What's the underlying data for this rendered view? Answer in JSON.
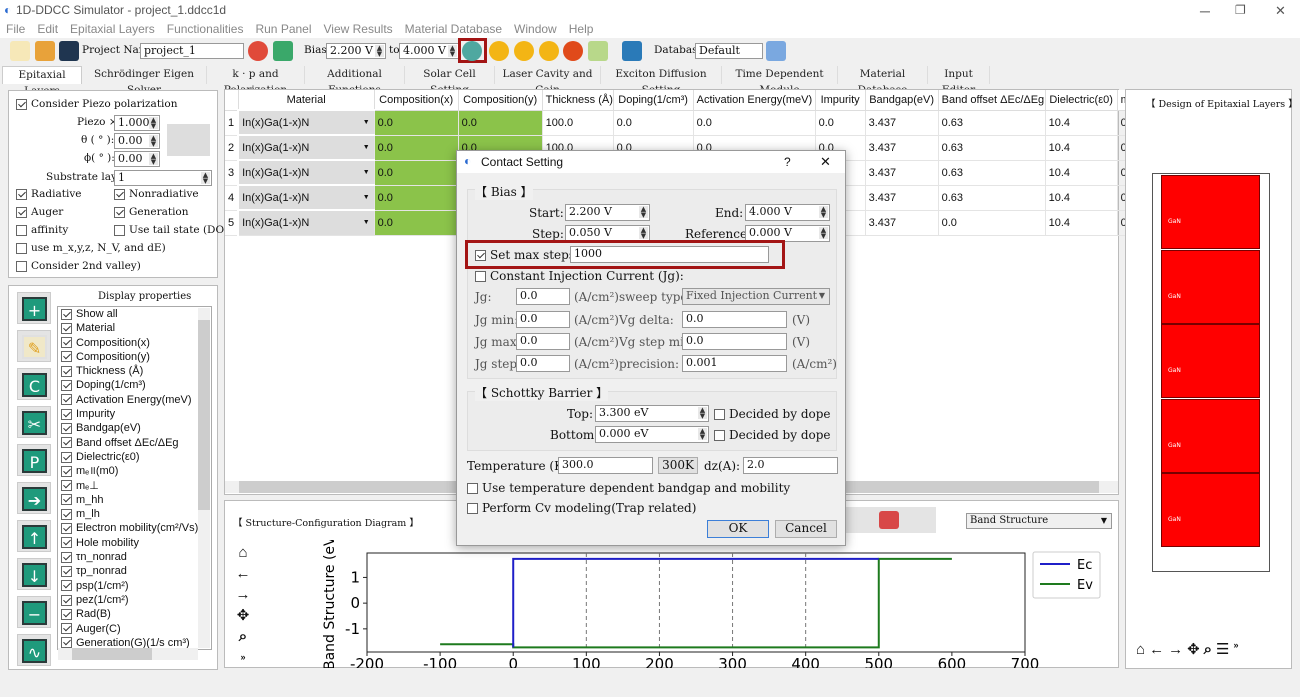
{
  "window": {
    "title": "1D-DDCC Simulator - project_1.ddcc1d"
  },
  "menu": [
    "File",
    "Edit",
    "Epitaxial Layers",
    "Functionalities",
    "Run Panel",
    "View Results",
    "Material Database",
    "Window",
    "Help"
  ],
  "toolbar": {
    "project_name_label": "Project Name:",
    "project_name": "project_1",
    "bias_label": "Bias:",
    "bias_from": "2.200 V",
    "to_label": "to",
    "bias_to": "4.000 V",
    "database_label": "Database:",
    "database": "Default",
    "highlight_color": "#a31515"
  },
  "tabs": [
    "Epitaxial Layers",
    "Schrödinger Eigen Solver",
    "k · p and Polarization",
    "Additional Functions",
    "Solar Cell Setting",
    "Laser Cavity and Gain",
    "Exciton Diffusion Setting",
    "Time Dependent Module",
    "Material Database",
    "Input Editor"
  ],
  "left_top": {
    "piezo_polarization": "Consider Piezo polarization",
    "piezo_label": "Piezo ×",
    "piezo_value": "1.000",
    "theta_label": "θ ( ° ):",
    "theta_value": "0.00",
    "phi_label": "ϕ( ° ):",
    "phi_value": "0.00",
    "substrate_label": "Substrate layer:",
    "substrate_value": "1",
    "radiative": "Radiative",
    "nonradiative": "Nonradiative",
    "auger": "Auger",
    "generation": "Generation",
    "affinity": "affinity",
    "tail_state": "Use tail state (DOE)",
    "use_m": "use m_x,y,z, N_V, and dE)",
    "second_valley": "Consider 2nd valley)"
  },
  "display_properties": {
    "title": "Display properties",
    "items": [
      "Show all",
      "Material",
      "Composition(x)",
      "Composition(y)",
      "Thickness (Å)",
      "Doping(1/cm³)",
      "Activation Energy(meV)",
      "Impurity",
      "Bandgap(eV)",
      "Band offset ΔEc/ΔEg",
      "Dielectric(ε0)",
      "mₑ॥(m0)",
      "mₑ⊥",
      "m_hh",
      "m_lh",
      "Electron mobility(cm²/Vs)",
      "Hole mobility",
      "τn_nonrad",
      "τp_nonrad",
      "psp(1/cm²)",
      "pez(1/cm²)",
      "Rad(B)",
      "Auger(C)",
      "Generation(G)(1/s cm³)"
    ]
  },
  "table": {
    "columns": [
      "Material",
      "Composition(x)",
      "Composition(y)",
      "Thickness (Å)",
      "Doping(1/cm³)",
      "Activation Energy(meV)",
      "Impurity",
      "Bandgap(eV)",
      "Band offset ΔEc/ΔEg",
      "Dielectric(ε0)",
      "m"
    ],
    "rows": [
      [
        "In(x)Ga(1-x)N",
        "0.0",
        "0.0",
        "100.0",
        "0.0",
        "0.0",
        "0.0",
        "3.437",
        "0.63",
        "10.4",
        "0"
      ],
      [
        "In(x)Ga(1-x)N",
        "0.0",
        "0.0",
        "100.0",
        "0.0",
        "0.0",
        "0.0",
        "3.437",
        "0.63",
        "10.4",
        "0"
      ],
      [
        "In(x)Ga(1-x)N",
        "0.0",
        "",
        "",
        "",
        "",
        "",
        "3.437",
        "0.63",
        "10.4",
        "0"
      ],
      [
        "In(x)Ga(1-x)N",
        "0.0",
        "",
        "",
        "",
        "",
        "",
        "3.437",
        "0.63",
        "10.4",
        "0"
      ],
      [
        "In(x)Ga(1-x)N",
        "0.0",
        "",
        "",
        "",
        "",
        "",
        "3.437",
        "0.0",
        "10.4",
        "0"
      ]
    ]
  },
  "structure": {
    "title": "【 Structure-Configuration Diagram 】",
    "plot_select": "Band Structure"
  },
  "design": {
    "title": "【 Design of Epitaxial Layers 】",
    "layers": [
      "GaN",
      "GaN",
      "GaN",
      "GaN",
      "GaN"
    ],
    "layer_color": "#ff0000"
  },
  "dialog": {
    "title": "Contact Setting",
    "help": "?",
    "close": "✕",
    "bias_group": "【 Bias 】",
    "start_label": "Start:",
    "start": "2.200 V",
    "end_label": "End:",
    "end": "4.000 V",
    "step_label": "Step:",
    "step": "0.050 V",
    "reference_label": "Reference:",
    "reference": "0.000 V",
    "max_steps_label": "Set max steps:",
    "max_steps": "1000",
    "constant_injection": "Constant Injection Current (Jg):",
    "jg_label": "Jg:",
    "jg": "0.0",
    "jg_min_label": "Jg min:",
    "jg_min": "0.0",
    "jg_max_label": "Jg max:",
    "jg_max": "0.0",
    "jg_step_label": "Jg step:",
    "jg_step": "0.0",
    "unit_acm2": "(A/cm²)",
    "unit_v": "(V)",
    "sweep_type_label": "sweep type:",
    "sweep_type": "Fixed Injection Current",
    "vg_delta_label": "Vg delta:",
    "vg_delta": "0.0",
    "vg_step_min_label": "Vg step min:",
    "vg_step_min": "0.0",
    "precision_label": "precision:",
    "precision": "0.001",
    "schottky_group": "【 Schottky Barrier 】",
    "top_label": "Top:",
    "top": "3.300 eV",
    "bottom_label": "Bottom:",
    "bottom": "0.000 eV",
    "decided_by_dope": "Decided by dope",
    "temperature_label": "Temperature (K):",
    "temperature": "300.0",
    "btn_300k": "300K",
    "dz_label": "dz(A):",
    "dz": "2.0",
    "temp_dependent": "Use temperature dependent bandgap and mobility",
    "cv_modeling": "Perform Cv modeling(Trap related)",
    "ok": "OK",
    "cancel": "Cancel"
  },
  "chart_data": {
    "type": "line",
    "ylabel": "Band Structure (eV)",
    "xlim": [
      -200,
      700
    ],
    "ylim": [
      -1.9,
      1.95
    ],
    "xticks": [
      -200,
      -100,
      0,
      100,
      200,
      300,
      400,
      500,
      600,
      700
    ],
    "yticks": [
      1,
      0,
      -1
    ],
    "grid": "dashed vertical lines at layer boundaries",
    "boundaries": [
      100,
      200,
      300,
      400
    ],
    "legend_position": "outside-right",
    "series": [
      {
        "name": "Ec",
        "color": "#1f1fc8",
        "x": [
          0,
          0,
          500
        ],
        "y": [
          -1.72,
          1.72,
          1.72
        ]
      },
      {
        "name": "Ev",
        "color": "#1e7a1e",
        "x": [
          -100,
          0,
          0,
          500,
          500,
          600
        ],
        "y": [
          -1.6,
          -1.6,
          -1.72,
          -1.72,
          1.72,
          1.72
        ]
      }
    ]
  }
}
